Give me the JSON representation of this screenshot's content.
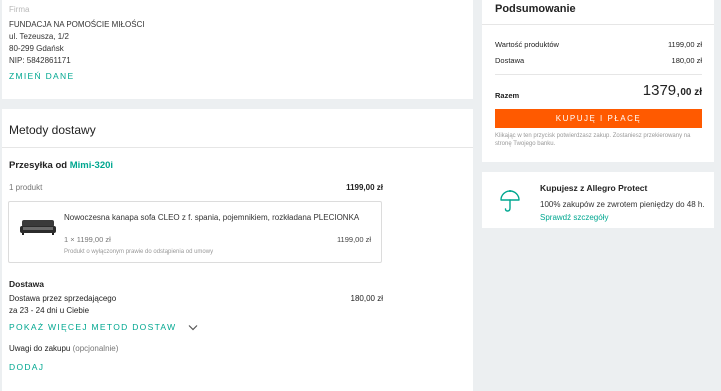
{
  "company": {
    "label": "Firma",
    "name": "FUNDACJA NA POMOŚCIE MIŁOŚCI",
    "street": "ul. Tezeusza, 1/2",
    "city": "80-299 Gdańsk",
    "nip": "NIP: 5842861171",
    "change_link": "ZMIEŃ DANE"
  },
  "delivery": {
    "section_title": "Metody dostawy",
    "shipment_prefix": "Przesyłka od",
    "seller": "Mimi-320i",
    "product_count": "1 produkt",
    "shipment_total": "1199,00 zł",
    "product": {
      "name": "Nowoczesna kanapa sofa CLEO z f. spania, pojemnikiem, rozkładana PLECIONKA",
      "qty_price": "1 × 1199,00 zł",
      "line_total": "1199,00 zł",
      "note": "Produkt o wyłączonym prawie do odstąpienia od umowy"
    },
    "delivery_heading": "Dostawa",
    "method": "Dostawa przez sprzedającego",
    "eta": "za 23 - 24 dni u Ciebie",
    "delivery_price": "180,00 zł",
    "more_methods": "POKAŻ WIĘCEJ METOD DOSTAW",
    "remarks_label": "Uwagi do zakupu",
    "remarks_optional": "(opcjonalnie)",
    "add_link": "DODAJ"
  },
  "summary": {
    "title": "Podsumowanie",
    "products_label": "Wartość produktów",
    "products_value": "1199,00 zł",
    "delivery_label": "Dostawa",
    "delivery_value": "180,00 zł",
    "total_label": "Razem",
    "total_main": "1379,",
    "total_fraction": "00 zł",
    "buy_button": "KUPUJĘ I PŁACĘ",
    "disclaimer": "Klikając w ten przycisk potwierdzasz zakup. Zostaniesz przekierowany na stronę Twojego banku."
  },
  "protect": {
    "title": "Kupujesz z Allegro Protect",
    "text": "100% zakupów ze zwrotem pieniędzy do 48 h.",
    "link": "Sprawdź szczegóły",
    "icon": "umbrella-icon",
    "accent": "#00a790"
  },
  "colors": {
    "accent": "#00a790",
    "buy": "#ff5a00",
    "background": "#eceff1"
  }
}
